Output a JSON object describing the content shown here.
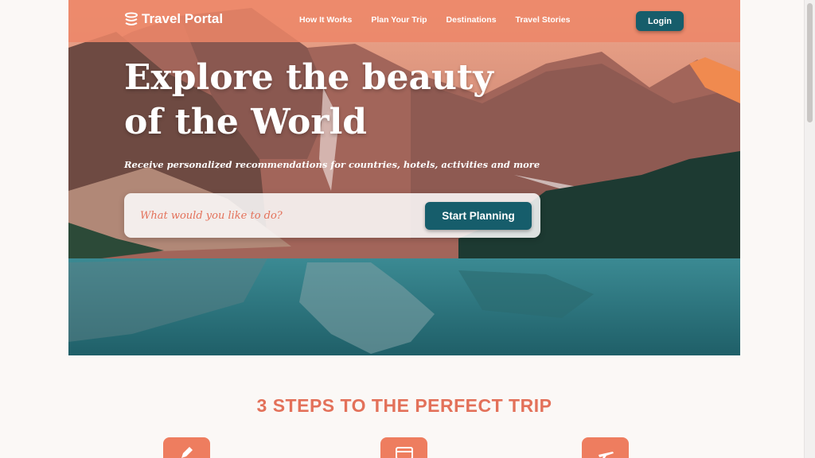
{
  "nav": {
    "brand": "Travel Portal",
    "links": [
      "How It Works",
      "Plan Your Trip",
      "Destinations",
      "Travel Stories"
    ],
    "login_label": "Login"
  },
  "hero": {
    "title": "Explore the beauty of the World",
    "subtitle": "Receive personalized recommendations for countries, hotels, activities and more",
    "search_placeholder": "What would you like to do?",
    "cta_label": "Start Planning"
  },
  "steps": {
    "title": "3 STEPS TO THE PERFECT TRIP",
    "icons": [
      "pencil-icon",
      "card-icon",
      "plane-icon"
    ]
  },
  "colors": {
    "accent": "#ee7d5f",
    "accent_text": "#e3715a",
    "primary_button": "#165d6b",
    "nav_bg": "#ec8668"
  }
}
